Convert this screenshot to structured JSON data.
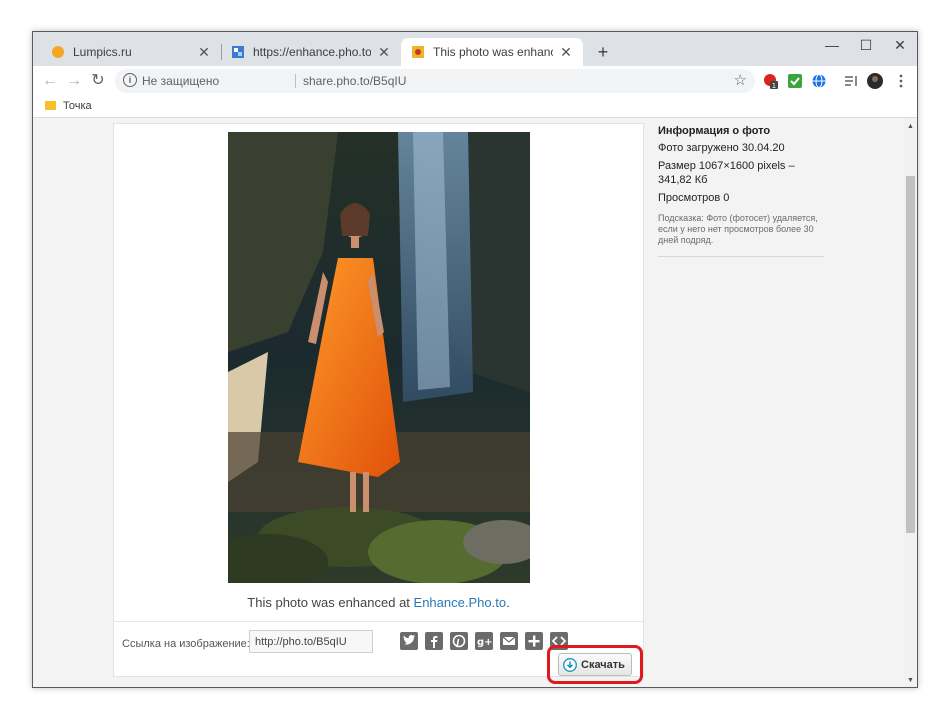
{
  "browser": {
    "tabs": [
      {
        "title": "Lumpics.ru",
        "favicon": "orange-circle-icon",
        "active": false
      },
      {
        "title": "https://enhance.pho.to/ru/",
        "favicon": "enhance-pho-to-icon",
        "active": false
      },
      {
        "title": "This photo was enhanced at Enh",
        "favicon": "enhance-pho-to-icon",
        "active": true
      }
    ],
    "new_tab_glyph": "+",
    "window_controls": {
      "minimize": "—",
      "maximize": "☐",
      "close": "✕"
    }
  },
  "toolbar": {
    "back_glyph": "←",
    "forward_glyph": "→",
    "reload_glyph": "↻",
    "security_label": "Не защищено",
    "url": "share.pho.to/B5qIU",
    "bookmark_glyph": "☆",
    "extension_badge": "1"
  },
  "bookmarks": {
    "items": [
      {
        "label": "Точка",
        "icon": "folder-icon"
      }
    ]
  },
  "page": {
    "caption_prefix": "This photo was enhanced at ",
    "caption_link": "Enhance.Pho.to",
    "caption_suffix": ".",
    "link_label": "Ссылка на изображение:",
    "link_value": "http://pho.to/B5qIU",
    "share_icons": [
      "twitter-icon",
      "facebook-icon",
      "pinterest-icon",
      "google-plus-icon",
      "email-icon",
      "add-icon",
      "embed-icon"
    ],
    "download_label": "Скачать",
    "highlight_color": "#e0191e",
    "link_color": "#2b79b8"
  },
  "info": {
    "heading": "Информация о фото",
    "uploaded": "Фото загружено 30.04.20",
    "size": "Размер 1067×1600 pixels – 341,82 Кб",
    "views": "Просмотров 0",
    "hint": "Подсказка: Фото (фотосет) удаляется, если у него нет просмотров более 30 дней подряд."
  }
}
